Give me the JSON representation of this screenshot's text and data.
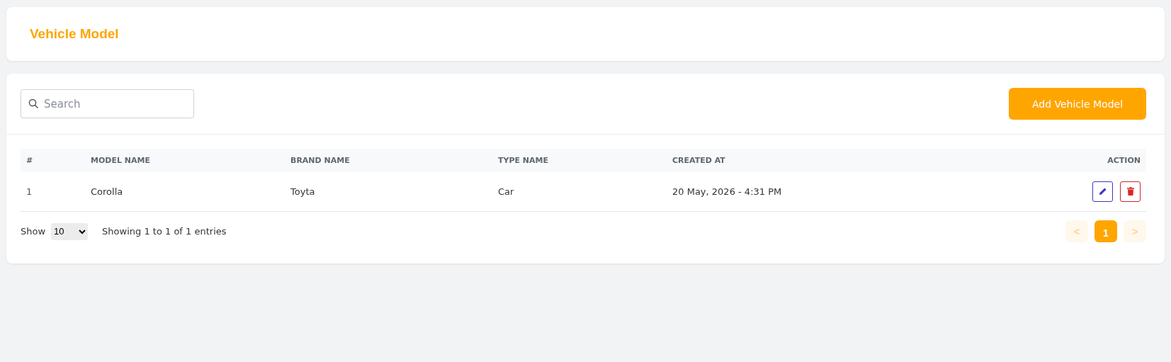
{
  "page_title": "Vehicle Model",
  "search": {
    "placeholder": "Search"
  },
  "add_button": "Add Vehicle Model",
  "table": {
    "columns": [
      "#",
      "MODEL NAME",
      "BRAND NAME",
      "TYPE NAME",
      "CREATED AT",
      "ACTION"
    ],
    "rows": [
      {
        "cells": [
          "1",
          "Corolla",
          "Toyta",
          "Car",
          "20 May, 2026 - 4:31 PM"
        ]
      }
    ]
  },
  "footer": {
    "show_label": "Show",
    "page_size": "10",
    "entries_text": "Showing 1 to 1 of 1 entries"
  },
  "pagination": [
    {
      "label": "<",
      "kind": "prev",
      "selected": false,
      "disabled": true
    },
    {
      "label": "1",
      "kind": "page",
      "selected": true,
      "disabled": false
    },
    {
      "label": ">",
      "kind": "next",
      "selected": false,
      "disabled": true
    }
  ]
}
